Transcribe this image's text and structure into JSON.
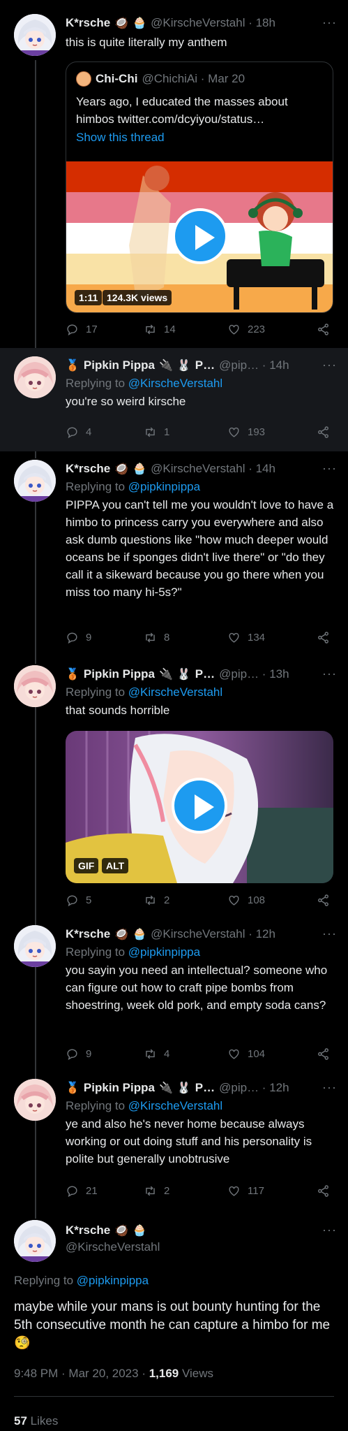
{
  "tweets": [
    {
      "name": "K*rsche",
      "emoji": [
        "🥥",
        "🧁"
      ],
      "handle": "@KirscheVerstahl · 18h",
      "text": "this is quite literally my anthem",
      "quote": {
        "name": "Chi-Chi",
        "handle": "@ChichiAi · Mar 20",
        "text": "Years ago, I educated the masses about himbos  twitter.com/dcyiyou/status…",
        "show_thread": "Show this thread",
        "video_duration": "1:11",
        "video_views": "124.3K views"
      },
      "stats": {
        "replies": "17",
        "retweets": "14",
        "likes": "223"
      }
    },
    {
      "name": "Pipkin Pippa",
      "emoji_pre": "🥉",
      "emoji": [
        "🔌",
        "🐰"
      ],
      "name_tail": "P…",
      "handle": "@pip… · 14h",
      "reply_prefix": "Replying to",
      "reply_to": "@KirscheVerstahl",
      "text": "you're so weird kirsche",
      "stats": {
        "replies": "4",
        "retweets": "1",
        "likes": "193"
      }
    },
    {
      "name": "K*rsche",
      "emoji": [
        "🥥",
        "🧁"
      ],
      "handle": "@KirscheVerstahl · 14h",
      "reply_prefix": "Replying to",
      "reply_to": "@pipkinpippa",
      "text": "PIPPA you can't tell me you wouldn't love to have a himbo to princess carry you everywhere and also ask dumb questions like \"how much deeper would oceans be if sponges didn't live there\" or \"do they call it a sikeward because you go there when you miss too many hi-5s?\"",
      "stats": {
        "replies": "9",
        "retweets": "8",
        "likes": "134"
      }
    },
    {
      "name": "Pipkin Pippa",
      "emoji_pre": "🥉",
      "emoji": [
        "🔌",
        "🐰"
      ],
      "name_tail": "P…",
      "handle": "@pip… · 13h",
      "reply_prefix": "Replying to",
      "reply_to": "@KirscheVerstahl",
      "text": "that sounds horrible",
      "gif_badge": "GIF",
      "alt_badge": "ALT",
      "stats": {
        "replies": "5",
        "retweets": "2",
        "likes": "108"
      }
    },
    {
      "name": "K*rsche",
      "emoji": [
        "🥥",
        "🧁"
      ],
      "handle": "@KirscheVerstahl · 12h",
      "reply_prefix": "Replying to",
      "reply_to": "@pipkinpippa",
      "text": "you sayin you need an intellectual? someone who can figure out how to craft pipe bombs from shoestring, week old pork, and empty soda cans?",
      "stats": {
        "replies": "9",
        "retweets": "4",
        "likes": "104"
      }
    },
    {
      "name": "Pipkin Pippa",
      "emoji_pre": "🥉",
      "emoji": [
        "🔌",
        "🐰"
      ],
      "name_tail": "P…",
      "handle": "@pip… · 12h",
      "reply_prefix": "Replying to",
      "reply_to": "@KirscheVerstahl",
      "text": "ye and also he's never home because always working or out doing stuff and his personality is polite but generally unobtrusive",
      "stats": {
        "replies": "21",
        "retweets": "2",
        "likes": "117"
      }
    }
  ],
  "main": {
    "name": "K*rsche",
    "emoji": [
      "🥥",
      "🧁"
    ],
    "handle": "@KirscheVerstahl",
    "reply_prefix": "Replying to",
    "reply_to": "@pipkinpippa",
    "text": "maybe while your mans is out bounty hunting for the 5th consecutive month he can capture a himbo for me 🧐",
    "timestamp": "9:48 PM · Mar 20, 2023 · ",
    "views_count": "1,169",
    "views_label": " Views",
    "likes_count": "57",
    "likes_label": " Likes"
  },
  "more_glyph": "···",
  "colors": {
    "background": "#000000",
    "accent": "#1d9bf0",
    "muted": "#71767b",
    "text": "#e7e9ea",
    "line": "#333639"
  },
  "icons": [
    "reply-icon",
    "retweet-icon",
    "like-icon",
    "share-icon",
    "play-icon",
    "more-icon"
  ]
}
